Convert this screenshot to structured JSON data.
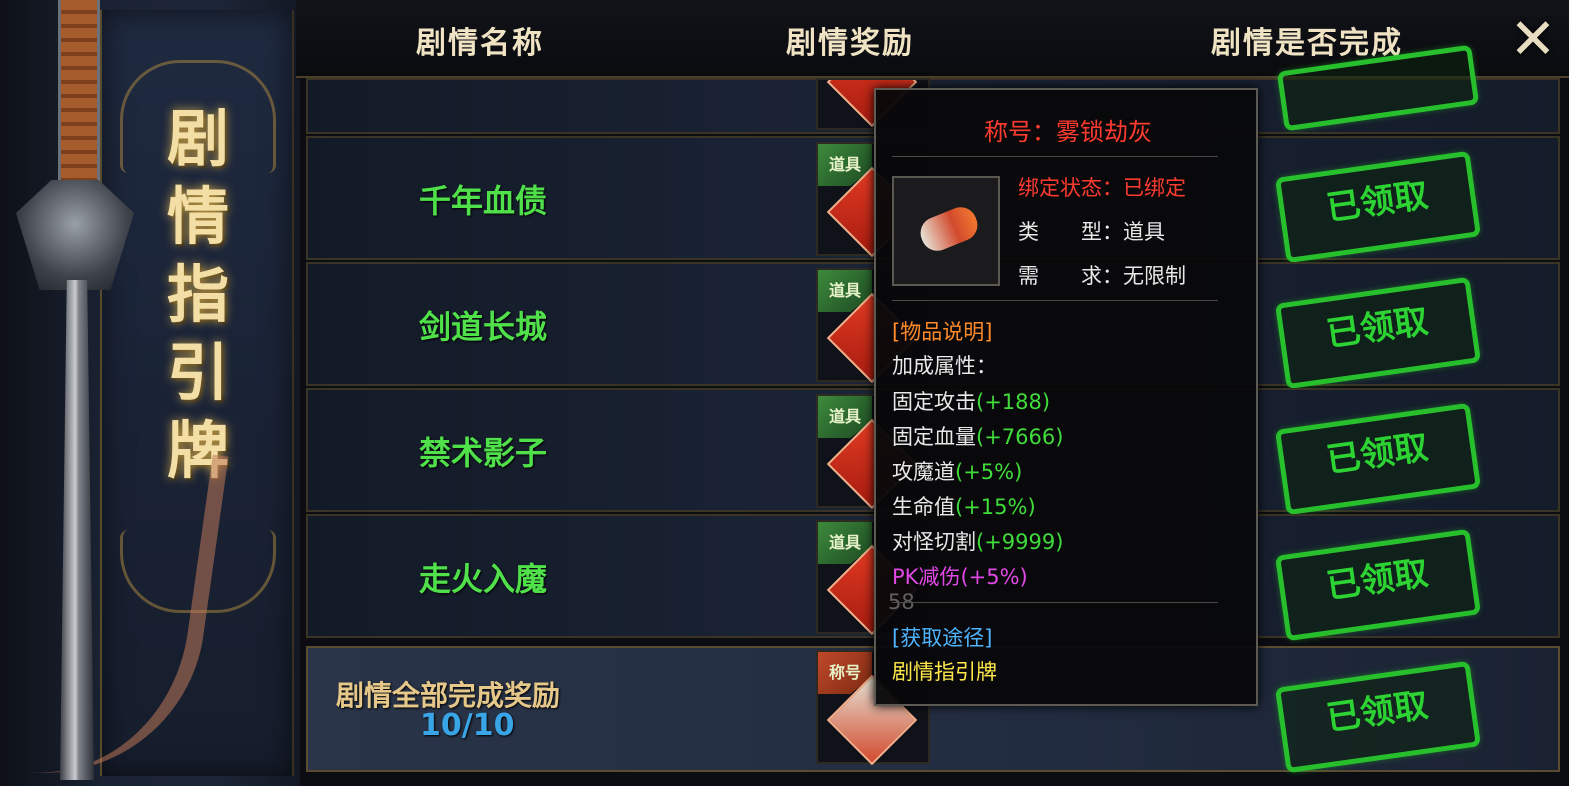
{
  "panel": {
    "title_chars": [
      "剧",
      "情",
      "指",
      "引",
      "牌"
    ]
  },
  "header": {
    "col_name": "剧情名称",
    "col_reward": "剧情奖励",
    "col_done": "剧情是否完成",
    "close_glyph": "✕"
  },
  "rows": [
    {
      "name": "千年血债",
      "reward_tag": "道具",
      "status": "已领取"
    },
    {
      "name": "剑道长城",
      "reward_tag": "道具",
      "status": "已领取"
    },
    {
      "name": "禁术影子",
      "reward_tag": "道具",
      "status": "已领取"
    },
    {
      "name": "走火入魔",
      "reward_tag": "道具",
      "status": "已领取"
    }
  ],
  "final": {
    "label": "剧情全部完成奖励",
    "progress": "10/10",
    "reward_tag": "称号",
    "status": "已领取"
  },
  "tooltip": {
    "title": "称号：雾锁劫灰",
    "bind_label": "绑定状态：已绑定",
    "type_label": "类　　型：道具",
    "req_label": "需　　求：无限制",
    "desc_header": "[物品说明]",
    "bonus_header": "加成属性：",
    "stats": [
      {
        "name": "固定攻击",
        "value": "(+188)",
        "color": "#3fdc3a"
      },
      {
        "name": "固定血量",
        "value": "(+7666)",
        "color": "#3fdc3a"
      },
      {
        "name": "攻魔道",
        "value": "(+5%)",
        "color": "#3fdc3a"
      },
      {
        "name": "生命值",
        "value": "(+15%)",
        "color": "#3fdc3a"
      },
      {
        "name": "对怪切割",
        "value": "(+9999)",
        "color": "#3fdc3a"
      },
      {
        "name": "PK减伤",
        "value": "(+5%)",
        "color": "#e048e6"
      }
    ],
    "obtain_header": "[获取途径]",
    "obtain_value": "剧情指引牌",
    "faint_number": "58"
  },
  "colors": {
    "name_green": "#4fe04a",
    "stamp_green": "#2cd332",
    "title_gold": "#f3dfa6",
    "tooltip_red": "#ff3b30"
  }
}
